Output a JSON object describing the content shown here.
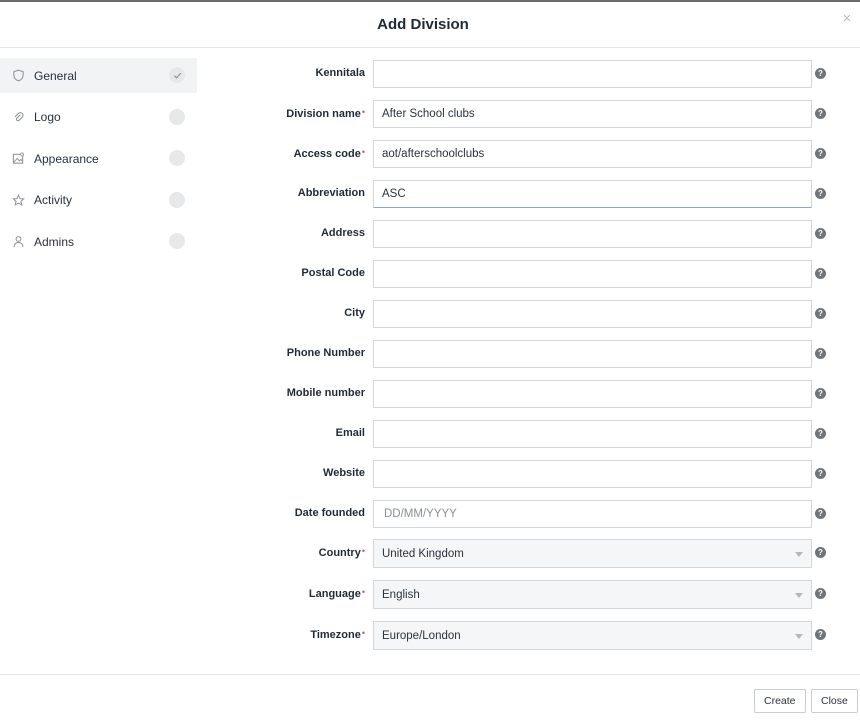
{
  "dialog": {
    "title": "Add Division",
    "close_glyph": "×"
  },
  "sidebar": {
    "items": [
      {
        "label": "General",
        "icon": "shield-icon",
        "status": "completed"
      },
      {
        "label": "Logo",
        "icon": "paperclip-icon",
        "status": "pending"
      },
      {
        "label": "Appearance",
        "icon": "image-icon",
        "status": "pending"
      },
      {
        "label": "Activity",
        "icon": "star-icon",
        "status": "pending"
      },
      {
        "label": "Admins",
        "icon": "person-icon",
        "status": "pending"
      }
    ]
  },
  "form": {
    "kennitala": {
      "label": "Kennitala",
      "value": ""
    },
    "division_name": {
      "label": "Division name",
      "value": "After School clubs",
      "required": true
    },
    "access_code": {
      "label": "Access code",
      "value": "aot/afterschoolclubs",
      "required": true
    },
    "abbreviation": {
      "label": "Abbreviation",
      "value": "ASC"
    },
    "address": {
      "label": "Address",
      "value": ""
    },
    "postal_code": {
      "label": "Postal Code",
      "value": ""
    },
    "city": {
      "label": "City",
      "value": ""
    },
    "phone_number": {
      "label": "Phone Number",
      "value": ""
    },
    "mobile_number": {
      "label": "Mobile number",
      "value": ""
    },
    "email": {
      "label": "Email",
      "value": ""
    },
    "website": {
      "label": "Website",
      "value": ""
    },
    "date_founded": {
      "label": "Date founded",
      "value": "",
      "placeholder": "DD/MM/YYYY"
    },
    "country": {
      "label": "Country",
      "value": "United Kingdom",
      "required": true
    },
    "language": {
      "label": "Language",
      "value": "English",
      "required": true
    },
    "timezone": {
      "label": "Timezone",
      "value": "Europe/London",
      "required": true
    }
  },
  "help_glyph": "?",
  "required_marker": "•",
  "footer": {
    "create_label": "Create",
    "close_label": "Close"
  },
  "colors": {
    "required": "#d9534f",
    "help_icon": "#6f7479",
    "focus_border": "#8aa6d6"
  }
}
